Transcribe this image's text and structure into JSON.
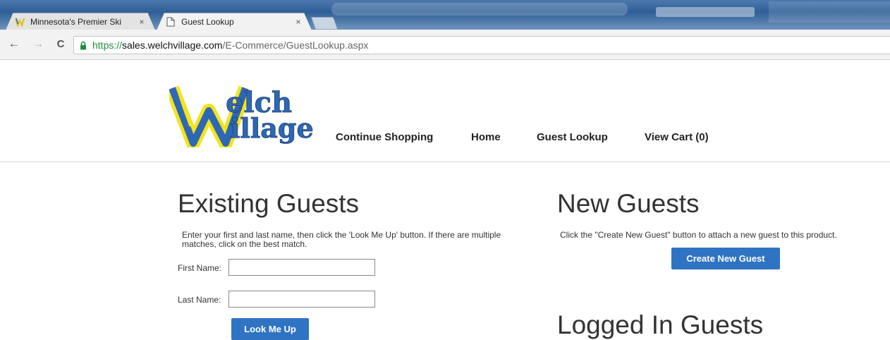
{
  "browser": {
    "tabs": [
      {
        "title": "Minnesota's Premier Ski",
        "close": "×",
        "icon": "welch-village-favicon"
      },
      {
        "title": "Guest Lookup",
        "close": "×",
        "icon": "page-icon"
      }
    ],
    "nav": {
      "back": "←",
      "forward": "→",
      "reload": "C"
    },
    "url_scheme": "https://",
    "url_host": "sales.welchvillage.com",
    "url_path": "/E-Commerce/GuestLookup.aspx"
  },
  "header": {
    "logo_text_top": "elch",
    "logo_text_bottom": "illage",
    "nav": [
      {
        "label": "Continue Shopping"
      },
      {
        "label": "Home"
      },
      {
        "label": "Guest Lookup"
      },
      {
        "label": "View Cart (0)"
      }
    ]
  },
  "existing": {
    "title": "Existing Guests",
    "instructions": "Enter your first and last name, then click the 'Look Me Up' button. If there are multiple matches, click on the best match.",
    "first_name_label": "First Name:",
    "first_name_value": "",
    "last_name_label": "Last Name:",
    "last_name_value": "",
    "button": "Look Me Up"
  },
  "new_guests": {
    "title": "New Guests",
    "instructions": "Click the \"Create New Guest\" button to attach a new guest to this product.",
    "button": "Create New Guest"
  },
  "logged_in": {
    "title": "Logged In Guests"
  },
  "colors": {
    "button_blue": "#2f73c3",
    "logo_blue": "#2e67b4",
    "logo_yellow": "#f2e31d"
  }
}
